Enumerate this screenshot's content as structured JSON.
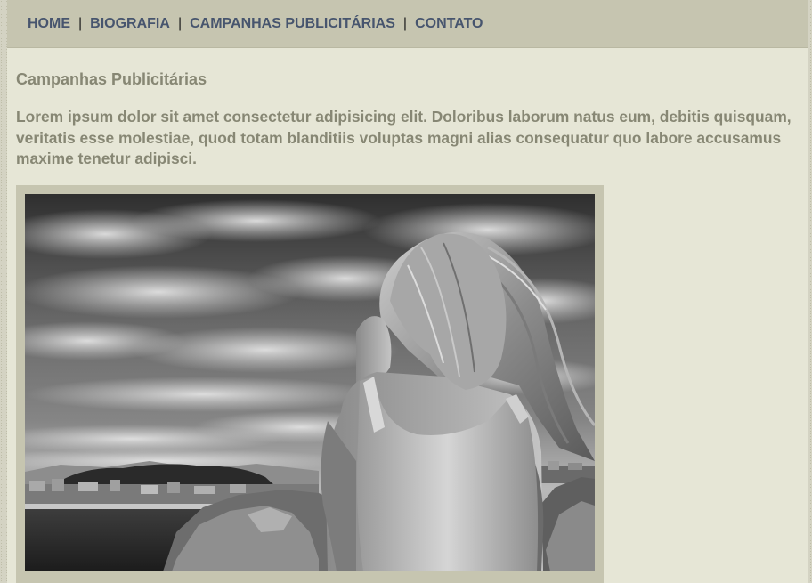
{
  "nav": {
    "items": [
      {
        "label": "HOME"
      },
      {
        "label": "BIOGRAFIA"
      },
      {
        "label": "CAMPANHAS PUBLICITÁRIAS"
      },
      {
        "label": "CONTATO"
      }
    ],
    "separator": "|"
  },
  "main": {
    "title": "Campanhas Publicitárias",
    "intro": "Lorem ipsum dolor sit amet consectetur adipisicing elit. Doloribus laborum natus eum, debitis quisquam, veritatis esse molestiae, quod totam blanditiis voluptas magni alias consequatur quo labore accusamus maxime tenetur adipisci."
  },
  "colors": {
    "nav_bar": "#c6c5b0",
    "nav_link": "#47556e",
    "page_bg": "#e6e6d6",
    "heading_text": "#878774"
  }
}
